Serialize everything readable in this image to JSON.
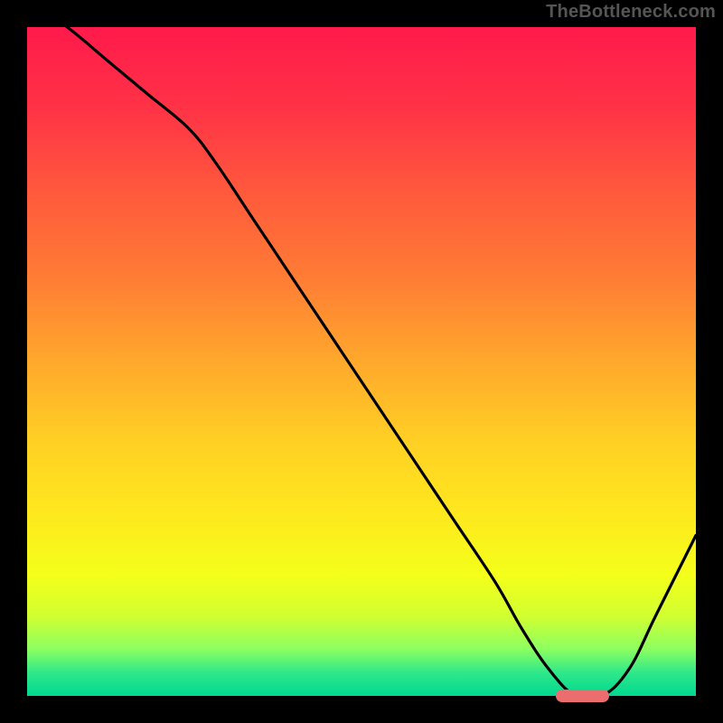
{
  "watermark": "TheBottleneck.com",
  "colors": {
    "bg": "#000000",
    "curve": "#000000",
    "marker": "#ec6d6d",
    "gradient_stops": [
      {
        "offset": 0.0,
        "color": "#ff1a4b"
      },
      {
        "offset": 0.12,
        "color": "#ff3246"
      },
      {
        "offset": 0.25,
        "color": "#ff5a3c"
      },
      {
        "offset": 0.38,
        "color": "#ff7e34"
      },
      {
        "offset": 0.5,
        "color": "#ffa82c"
      },
      {
        "offset": 0.62,
        "color": "#ffd024"
      },
      {
        "offset": 0.72,
        "color": "#ffe61e"
      },
      {
        "offset": 0.82,
        "color": "#f4ff1a"
      },
      {
        "offset": 0.88,
        "color": "#d2ff30"
      },
      {
        "offset": 0.93,
        "color": "#8cff60"
      },
      {
        "offset": 0.965,
        "color": "#30e88a"
      },
      {
        "offset": 1.0,
        "color": "#00d890"
      }
    ]
  },
  "chart_data": {
    "type": "line",
    "title": "",
    "xlabel": "",
    "ylabel": "",
    "xlim": [
      0,
      100
    ],
    "ylim": [
      0,
      100
    ],
    "series": [
      {
        "name": "curve",
        "x": [
          0,
          6,
          12,
          18,
          24,
          28,
          34,
          40,
          46,
          52,
          58,
          64,
          70,
          74,
          78,
          82,
          86,
          90,
          94,
          100
        ],
        "y": [
          104,
          100,
          95,
          90,
          85,
          80,
          71,
          62,
          53,
          44,
          35,
          26,
          17,
          10,
          4,
          0,
          0,
          4,
          12,
          24
        ]
      }
    ],
    "marker": {
      "x_start": 79,
      "x_end": 87,
      "y": 0
    },
    "grid": false,
    "legend": false
  }
}
